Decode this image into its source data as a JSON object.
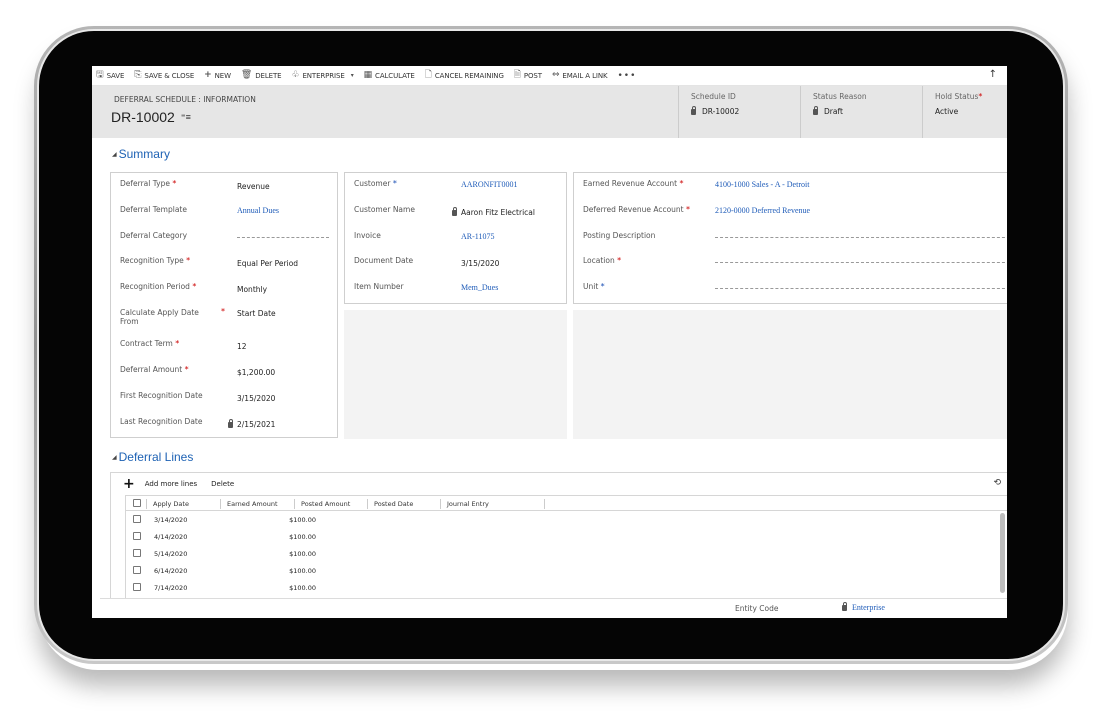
{
  "toolbar": {
    "items": [
      {
        "label": "SAVE",
        "icon": "save-icon"
      },
      {
        "label": "SAVE & CLOSE",
        "icon": "save-close-icon"
      },
      {
        "label": "NEW",
        "icon": "plus-icon"
      },
      {
        "label": "DELETE",
        "icon": "trash-icon"
      },
      {
        "label": "ENTERPRISE",
        "icon": "enterprise-icon",
        "dropdown": true
      },
      {
        "label": "CALCULATE",
        "icon": "calculator-icon"
      },
      {
        "label": "CANCEL REMAINING",
        "icon": "cancel-doc-icon"
      },
      {
        "label": "POST",
        "icon": "post-doc-icon"
      },
      {
        "label": "EMAIL A LINK",
        "icon": "link-icon"
      }
    ],
    "more_label": "•••",
    "collapse_icon": "↑"
  },
  "header": {
    "entity_label": "DEFERRAL SCHEDULE : INFORMATION",
    "title": "DR-10002",
    "fields": [
      {
        "label": "Schedule ID",
        "value": "DR-10002",
        "locked": true,
        "required": false
      },
      {
        "label": "Status Reason",
        "value": "Draft",
        "locked": true,
        "required": false
      },
      {
        "label": "Hold Status",
        "value": "Active",
        "locked": false,
        "required": true
      }
    ]
  },
  "summary": {
    "title": "Summary",
    "left_panel": [
      {
        "label": "Deferral Type",
        "value": "Revenue",
        "required": true
      },
      {
        "label": "Deferral Template",
        "value": "Annual Dues",
        "link": true
      },
      {
        "label": "Deferral Category",
        "value": "",
        "empty": true
      },
      {
        "label": "Recognition Type",
        "value": "Equal Per Period",
        "required": true
      },
      {
        "label": "Recognition Period",
        "value": "Monthly",
        "required": true
      },
      {
        "label": "Calculate Apply Date From",
        "value": "Start Date",
        "required": true
      },
      {
        "label": "Contract Term",
        "value": "12",
        "required": true
      },
      {
        "label": "Deferral Amount",
        "value": "$1,200.00",
        "required": true
      },
      {
        "label": "First Recognition Date",
        "value": "3/15/2020"
      },
      {
        "label": "Last Recognition Date",
        "value": "2/15/2021",
        "locked": true
      }
    ],
    "middle_panel": [
      {
        "label": "Customer",
        "value": "AARONFIT0001",
        "required_blue": true,
        "link": true
      },
      {
        "label": "Customer Name",
        "value": "Aaron Fitz Electrical",
        "locked": true
      },
      {
        "label": "Invoice",
        "value": "AR-11075",
        "link": true
      },
      {
        "label": "Document Date",
        "value": "3/15/2020"
      },
      {
        "label": "Item Number",
        "value": "Mem_Dues",
        "link": true
      }
    ],
    "right_panel": [
      {
        "label": "Earned Revenue Account",
        "value": "4100-1000 Sales - A - Detroit",
        "required": true,
        "link": true
      },
      {
        "label": "Deferred Revenue Account",
        "value": "2120-0000 Deferred Revenue",
        "required": true,
        "link": true
      },
      {
        "label": "Posting Description",
        "value": "",
        "empty": true
      },
      {
        "label": "Location",
        "value": "",
        "required": true,
        "empty": true
      },
      {
        "label": "Unit",
        "value": "",
        "required_blue": true,
        "empty": true
      }
    ]
  },
  "deferral_lines": {
    "title": "Deferral Lines",
    "add_label": "Add more lines",
    "delete_label": "Delete",
    "columns": [
      "Apply Date",
      "Earned Amount",
      "Posted Amount",
      "Posted Date",
      "Journal Entry"
    ],
    "rows": [
      {
        "apply_date": "3/14/2020",
        "earned_amount": "$100.00",
        "posted_amount": "",
        "posted_date": "",
        "journal_entry": ""
      },
      {
        "apply_date": "4/14/2020",
        "earned_amount": "$100.00",
        "posted_amount": "",
        "posted_date": "",
        "journal_entry": ""
      },
      {
        "apply_date": "5/14/2020",
        "earned_amount": "$100.00",
        "posted_amount": "",
        "posted_date": "",
        "journal_entry": ""
      },
      {
        "apply_date": "6/14/2020",
        "earned_amount": "$100.00",
        "posted_amount": "",
        "posted_date": "",
        "journal_entry": ""
      },
      {
        "apply_date": "7/14/2020",
        "earned_amount": "$100.00",
        "posted_amount": "",
        "posted_date": "",
        "journal_entry": ""
      }
    ]
  },
  "footer": {
    "label": "Entity Code",
    "value": "Enterprise",
    "locked": true
  },
  "colors": {
    "link": "#1e5bb8",
    "section_title": "#1e62b4",
    "required": "#cc0000",
    "header_bg": "#e6e6e6"
  }
}
